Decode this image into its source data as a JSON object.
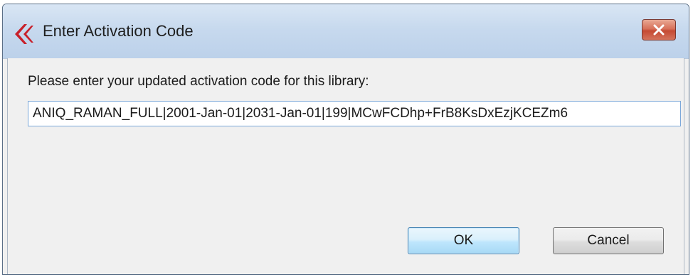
{
  "window": {
    "title": "Enter Activation Code",
    "app_icon": "red-chevron-logo-icon",
    "close_icon": "close-x-icon"
  },
  "dialog": {
    "prompt": "Please enter your updated activation code for this library:",
    "activation_code_value": "ANIQ_RAMAN_FULL|2001-Jan-01|2031-Jan-01|199|MCwFCDhp+FrB8KsDxEzjKCEZm6",
    "ok_label": "OK",
    "cancel_label": "Cancel"
  },
  "colors": {
    "titlebar": "#c7d9ee",
    "close_button": "#c54a33",
    "dialog_background": "#f0f0f0",
    "ok_button_focus_border": "#3c7fb1",
    "input_border": "#7aa7d9",
    "logo_red": "#c8202a"
  }
}
